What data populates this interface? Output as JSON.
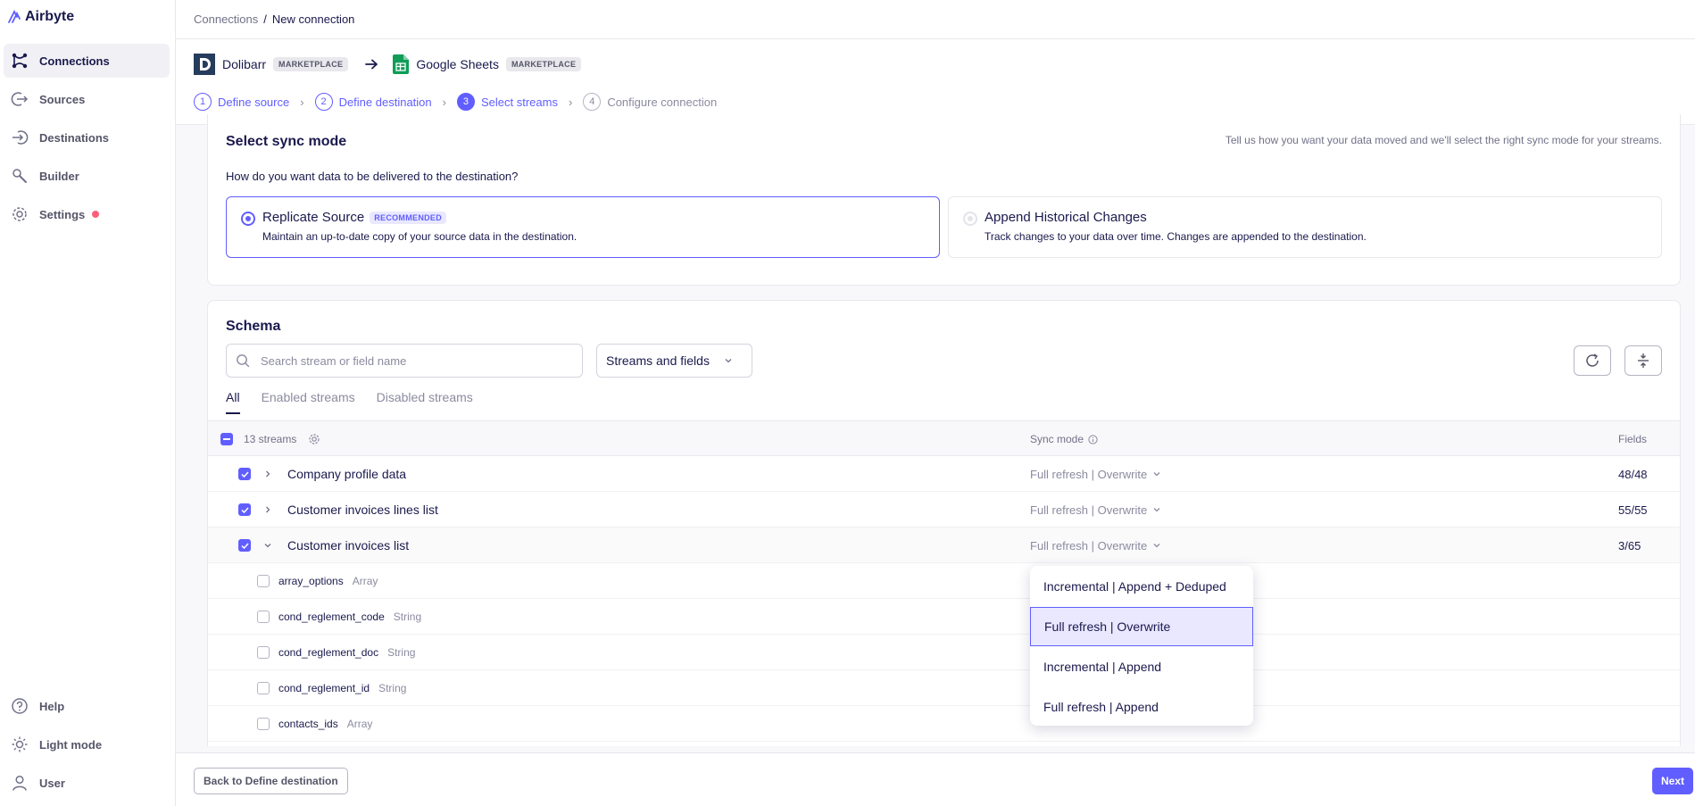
{
  "app": {
    "name": "Airbyte"
  },
  "sidebar": {
    "items": [
      {
        "label": "Connections",
        "icon": "connections-icon",
        "active": true
      },
      {
        "label": "Sources",
        "icon": "sources-icon"
      },
      {
        "label": "Destinations",
        "icon": "destinations-icon"
      },
      {
        "label": "Builder",
        "icon": "builder-icon"
      },
      {
        "label": "Settings",
        "icon": "gear-icon",
        "notification": true
      }
    ],
    "bottom": [
      {
        "label": "Help",
        "icon": "help-icon"
      },
      {
        "label": "Light mode",
        "icon": "sun-icon"
      },
      {
        "label": "User",
        "icon": "user-icon"
      }
    ]
  },
  "breadcrumb": {
    "parent": "Connections",
    "separator": "/",
    "current": "New connection"
  },
  "connection": {
    "source": {
      "name": "Dolibarr",
      "badge": "MARKETPLACE"
    },
    "destination": {
      "name": "Google Sheets",
      "badge": "MARKETPLACE"
    }
  },
  "steps": [
    {
      "num": "1",
      "label": "Define source",
      "state": "done"
    },
    {
      "num": "2",
      "label": "Define destination",
      "state": "done"
    },
    {
      "num": "3",
      "label": "Select streams",
      "state": "current"
    },
    {
      "num": "4",
      "label": "Configure connection",
      "state": "future"
    }
  ],
  "sync_mode": {
    "title": "Select sync mode",
    "hint": "Tell us how you want your data moved and we'll select the right sync mode for your streams.",
    "question": "How do you want data to be delivered to the destination?",
    "options": [
      {
        "title": "Replicate Source",
        "badge": "RECOMMENDED",
        "desc": "Maintain an up-to-date copy of your source data in the destination.",
        "selected": true
      },
      {
        "title": "Append Historical Changes",
        "desc": "Track changes to your data over time. Changes are appended to the destination.",
        "selected": false
      }
    ]
  },
  "schema": {
    "title": "Schema",
    "search_placeholder": "Search stream or field name",
    "filter_value": "Streams and fields",
    "tabs": [
      {
        "label": "All",
        "active": true
      },
      {
        "label": "Enabled streams"
      },
      {
        "label": "Disabled streams"
      }
    ],
    "header": {
      "count": "13 streams",
      "sync_mode": "Sync mode",
      "fields": "Fields"
    },
    "streams": [
      {
        "name": "Company profile data",
        "sync": "Full refresh | Overwrite",
        "fields": "48/48",
        "checked": true,
        "expanded": false
      },
      {
        "name": "Customer invoices lines list",
        "sync": "Full refresh | Overwrite",
        "fields": "55/55",
        "checked": true,
        "expanded": false
      },
      {
        "name": "Customer invoices list",
        "sync": "Full refresh | Overwrite",
        "fields": "3/65",
        "checked": true,
        "expanded": true
      }
    ],
    "fields": [
      {
        "name": "array_options",
        "type": "Array"
      },
      {
        "name": "cond_reglement_code",
        "type": "String"
      },
      {
        "name": "cond_reglement_doc",
        "type": "String"
      },
      {
        "name": "cond_reglement_id",
        "type": "String"
      },
      {
        "name": "contacts_ids",
        "type": "Array"
      }
    ]
  },
  "dropdown": {
    "options": [
      {
        "label": "Incremental | Append + Deduped"
      },
      {
        "label": "Full refresh | Overwrite",
        "selected": true
      },
      {
        "label": "Incremental | Append"
      },
      {
        "label": "Full refresh | Append"
      }
    ]
  },
  "footer": {
    "back_label": "Back to Define destination",
    "next_label": "Next"
  },
  "colors": {
    "accent": "#615eff",
    "text": "#1a194d",
    "muted": "#8b8ba0",
    "notification": "#ff5e7b"
  }
}
